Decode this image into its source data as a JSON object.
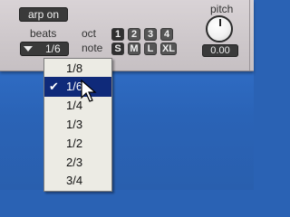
{
  "controls": {
    "arp_button": "arp on",
    "beats_label": "beats",
    "beats_value": "1/6",
    "oct_label": "oct",
    "note_label": "note",
    "oct_buttons": [
      "1",
      "2",
      "3",
      "4"
    ],
    "note_buttons": [
      "S",
      "M",
      "L",
      "XL"
    ],
    "pitch_label": "pitch",
    "pitch_value": "0.00"
  },
  "dropdown": {
    "selected": "1/6",
    "items": [
      "1/8",
      "1/6",
      "1/4",
      "1/3",
      "1/2",
      "2/3",
      "3/4"
    ]
  },
  "colors": {
    "panel": "#d3cdd0",
    "background": "#2a62b4",
    "selection": "#0f2a7a"
  }
}
